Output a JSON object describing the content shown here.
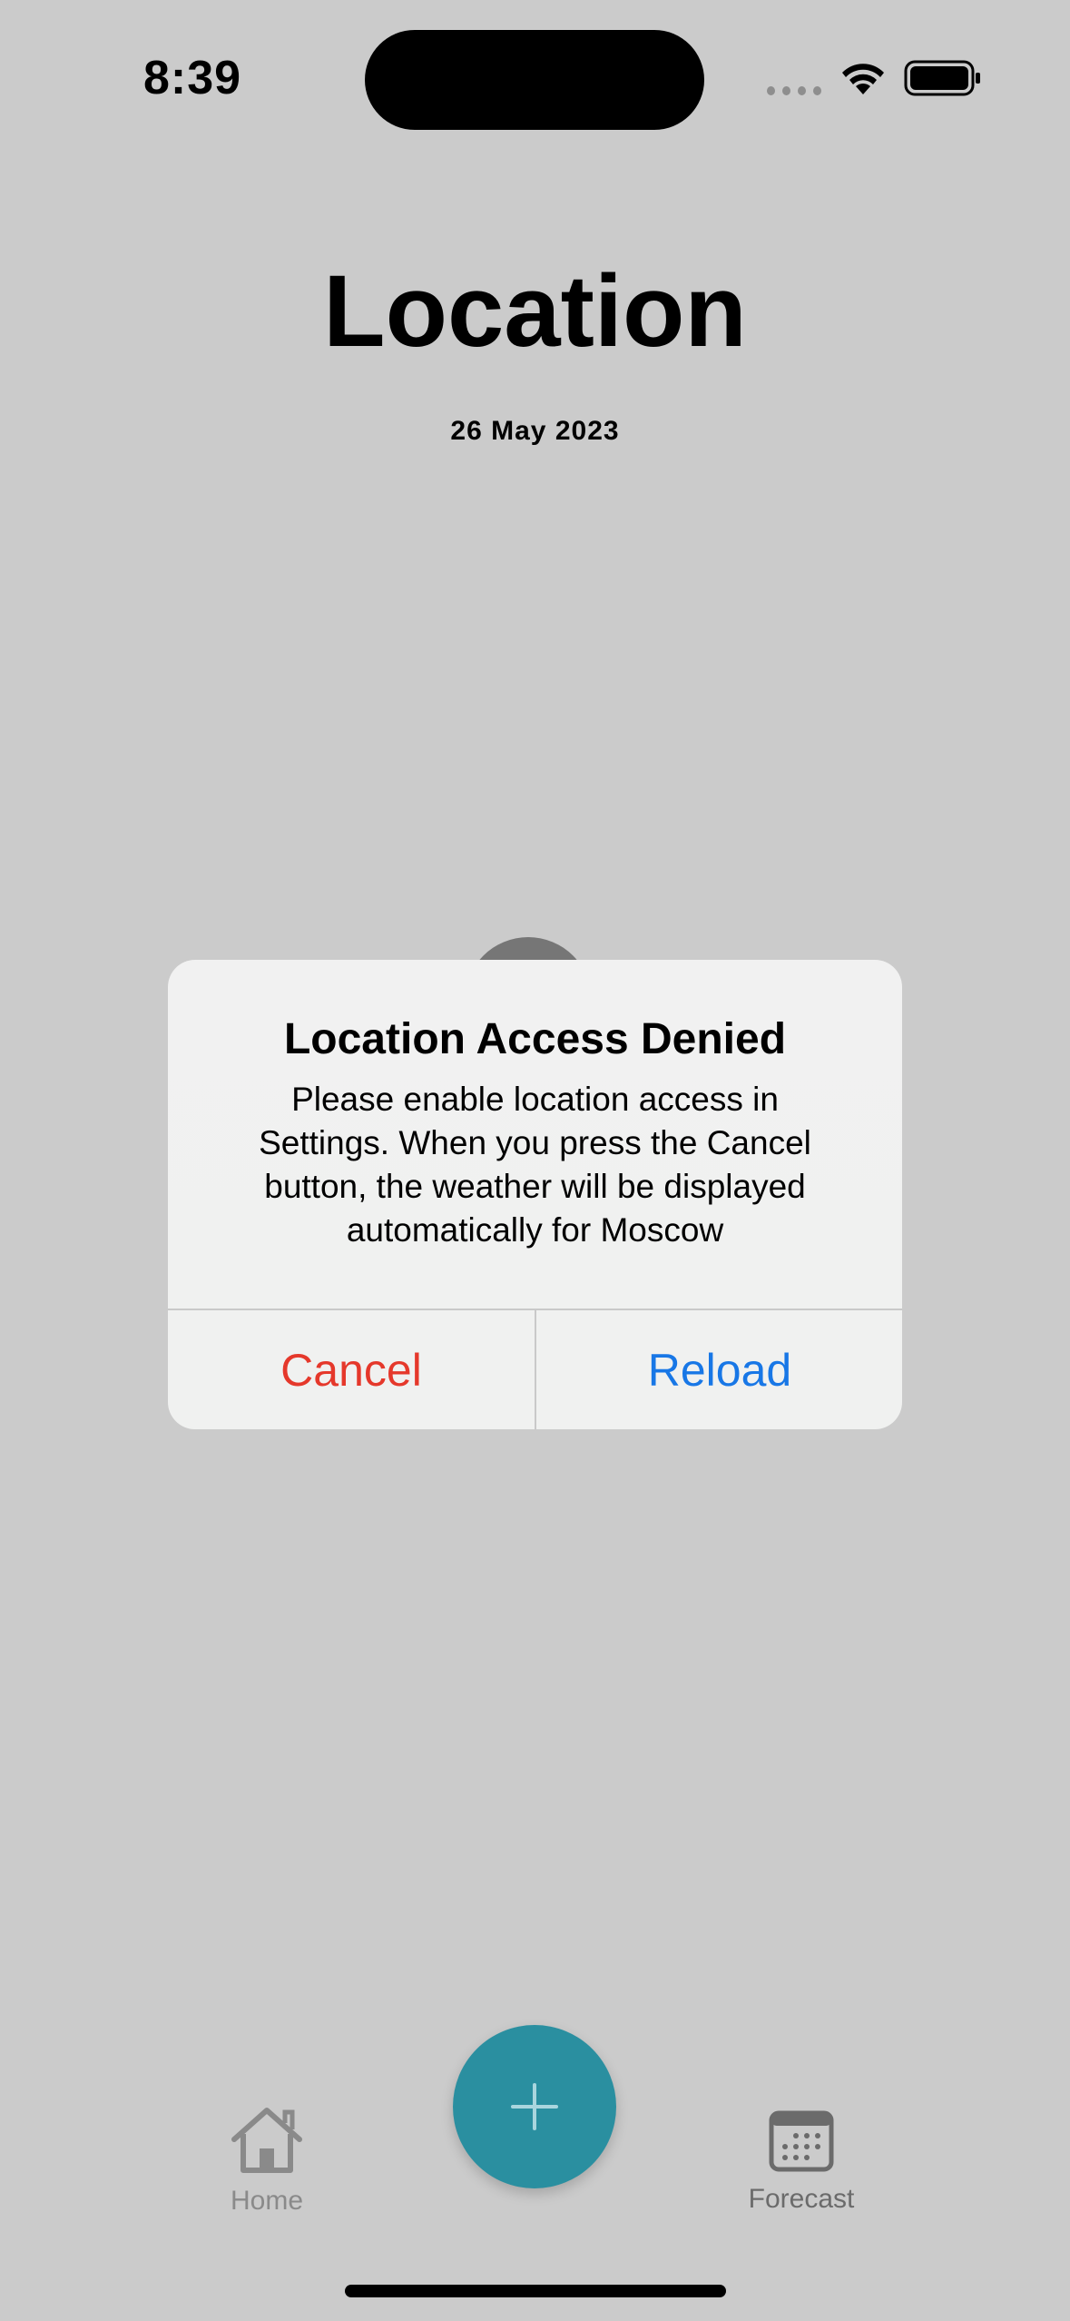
{
  "status_bar": {
    "time": "8:39",
    "icons": [
      "signal-icon",
      "wifi-icon",
      "battery-icon"
    ]
  },
  "header": {
    "title": "Location",
    "date": "26 May 2023"
  },
  "alert": {
    "title": "Location Access Denied",
    "message": "Please enable location access in Settings. When you press the Cancel button, the weather will be displayed automatically for Moscow",
    "cancel_label": "Cancel",
    "reload_label": "Reload",
    "cancel_color": "#e5382b",
    "reload_color": "#1877e6"
  },
  "tab_bar": {
    "home_label": "Home",
    "forecast_label": "Forecast",
    "add_button_icon": "plus-icon",
    "accent_color": "#2a8fa0"
  }
}
